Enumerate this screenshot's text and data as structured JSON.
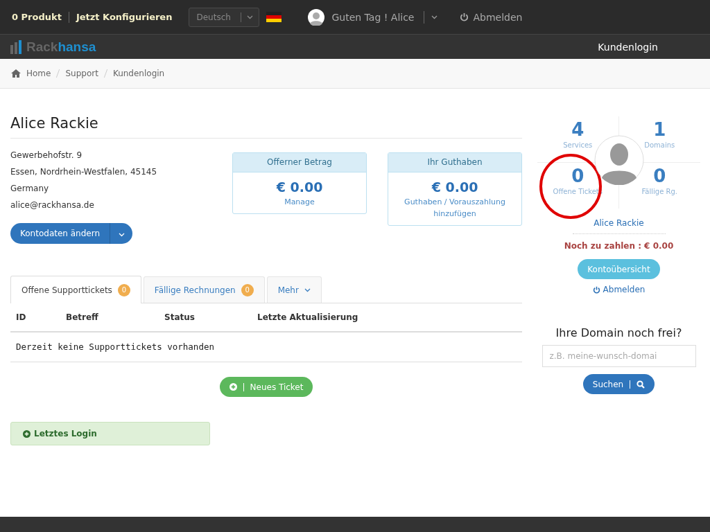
{
  "topbar": {
    "cart": "0 Produkt",
    "configure": "Jetzt Konfigurieren",
    "language": "Deutsch",
    "greeting": "Guten Tag ! Alice",
    "logout": "Abmelden"
  },
  "navbar": {
    "logo_a": "Rack",
    "logo_b": "hansa",
    "link": "Kundenlogin"
  },
  "breadcrumb": [
    "Home",
    "Support",
    "Kundenlogin"
  ],
  "profile": {
    "name": "Alice Rackie",
    "address": [
      "Gewerbehofstr. 9",
      "Essen, Nordrhein-Westfalen, 45145",
      "Germany",
      "alice@rackhansa.de"
    ],
    "edit_button": "Kontodaten ändern"
  },
  "panels": [
    {
      "title": "Offerner Betrag",
      "amount": "€ 0.00",
      "link": "Manage"
    },
    {
      "title": "Ihr Guthaben",
      "amount": "€ 0.00",
      "link": "Guthaben / Vorauszahlung hinzufügen"
    }
  ],
  "tabs": [
    {
      "label": "Offene Supporttickets",
      "badge": "0",
      "selected": true
    },
    {
      "label": "Fällige Rechnungen",
      "badge": "0",
      "selected": false
    },
    {
      "label": "Mehr",
      "selected": false
    }
  ],
  "table": {
    "columns": [
      "ID",
      "Betreff",
      "Status",
      "Letzte Aktualisierung"
    ],
    "empty": "Derzeit keine Supporttickets vorhanden"
  },
  "new_ticket": "Neues Ticket",
  "last_login": "Letztes Login",
  "stats": [
    {
      "value": "4",
      "label": "Services",
      "highlighted": false
    },
    {
      "value": "1",
      "label": "Domains",
      "highlighted": false
    },
    {
      "value": "0",
      "label": "Offene Tickets",
      "highlighted": true
    },
    {
      "value": "0",
      "label": "Fällige Rg.",
      "highlighted": false
    }
  ],
  "sidebar": {
    "name": "Alice Rackie",
    "due": "Noch zu zahlen : € 0.00",
    "overview_button": "Kontoübersicht",
    "logout": "Abmelden"
  },
  "domain_search": {
    "title": "Ihre Domain noch frei?",
    "placeholder": "z.B. meine-wunsch-domai",
    "button": "Suchen"
  }
}
